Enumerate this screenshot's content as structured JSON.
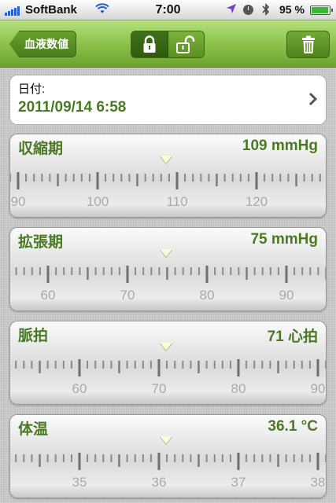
{
  "status_bar": {
    "carrier": "SoftBank",
    "time": "7:00",
    "battery": "95 %",
    "battery_level": 0.95
  },
  "nav": {
    "back_label": "血液数値",
    "lock_icons": [
      "lock-closed-icon",
      "lock-open-icon"
    ],
    "trash_icon": "trash-icon"
  },
  "date": {
    "label": "日付:",
    "value": "2011/09/14 6:58"
  },
  "colors": {
    "accent_green": "#4a7a23",
    "nav_green": "#8dc24a"
  },
  "measures": [
    {
      "label": "収縮期",
      "value": "109 mmHg",
      "ticks": [
        "90",
        "100",
        "110",
        "120"
      ]
    },
    {
      "label": "拡張期",
      "value": "75 mmHg",
      "ticks": [
        "60",
        "70",
        "80",
        "90"
      ]
    },
    {
      "label": "脈拍",
      "value": "71 心拍",
      "ticks": [
        "60",
        "70",
        "80",
        "90"
      ]
    },
    {
      "label": "体温",
      "value": "36.1 °C",
      "ticks": [
        "35",
        "36",
        "37",
        "38"
      ]
    }
  ]
}
